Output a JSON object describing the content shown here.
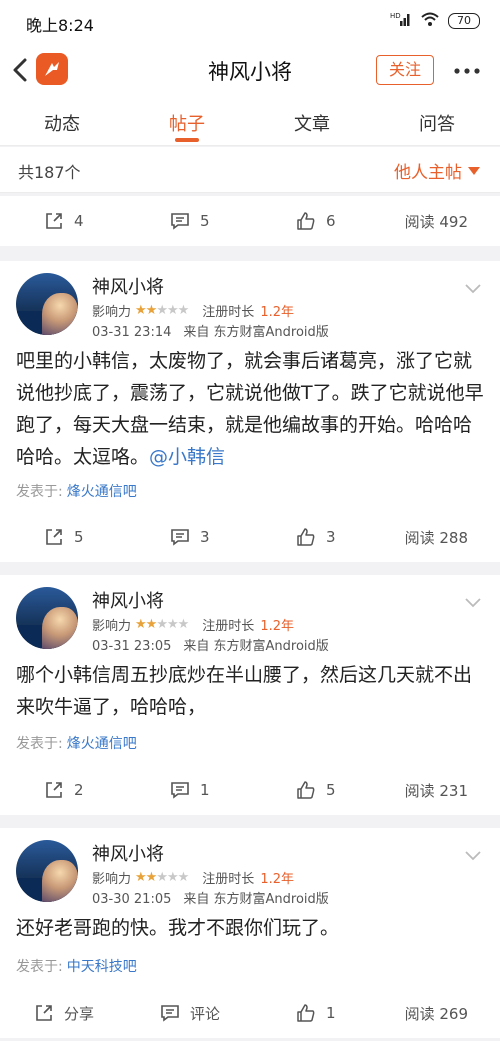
{
  "status_bar": {
    "time": "晚上8:24",
    "signal_label": "HD",
    "battery": "70"
  },
  "nav": {
    "title": "神风小将",
    "follow_label": "关注"
  },
  "tabs": [
    {
      "label": "动态",
      "active": false
    },
    {
      "label": "帖子",
      "active": true
    },
    {
      "label": "文章",
      "active": false
    },
    {
      "label": "问答",
      "active": false
    }
  ],
  "filter": {
    "count": "共187个",
    "dropdown_label": "他人主帖"
  },
  "top_actions": {
    "share": "4",
    "comment": "5",
    "like": "6",
    "read": "阅读 492"
  },
  "posts": [
    {
      "username": "神风小将",
      "influence_label": "影响力",
      "stars_on": 2,
      "reg_label": "注册时长",
      "reg_value": "1.2年",
      "time": "03-31 23:14",
      "source": "来自 东方财富Android版",
      "content": "吧里的小韩信，太废物了，就会事后诸葛亮，涨了它就说他抄底了，震荡了，它就说他做T了。跌了它就说他早跑了，每天大盘一结束，就是他编故事的开始。哈哈哈哈哈。太逗咯。",
      "mention": "@小韩信",
      "posted_in_label": "发表于:",
      "bar": "烽火通信吧",
      "actions": {
        "share": "5",
        "comment": "3",
        "like": "3",
        "read": "阅读 288"
      }
    },
    {
      "username": "神风小将",
      "influence_label": "影响力",
      "stars_on": 2,
      "reg_label": "注册时长",
      "reg_value": "1.2年",
      "time": "03-31 23:05",
      "source": "来自 东方财富Android版",
      "content": "哪个小韩信周五抄底炒在半山腰了，然后这几天就不出来吹牛逼了，哈哈哈，",
      "mention": "",
      "posted_in_label": "发表于:",
      "bar": "烽火通信吧",
      "actions": {
        "share": "2",
        "comment": "1",
        "like": "5",
        "read": "阅读 231"
      }
    },
    {
      "username": "神风小将",
      "influence_label": "影响力",
      "stars_on": 2,
      "reg_label": "注册时长",
      "reg_value": "1.2年",
      "time": "03-30 21:05",
      "source": "来自 东方财富Android版",
      "content": "还好老哥跑的快。我才不跟你们玩了。",
      "mention": "",
      "posted_in_label": "发表于:",
      "bar": "中天科技吧",
      "actions": {
        "share": "分享",
        "comment": "评论",
        "like": "1",
        "read": "阅读 269"
      }
    }
  ],
  "icons": {
    "back": "chevron-left-icon",
    "logo": "app-logo-icon",
    "more": "more-dots-icon",
    "share": "share-icon",
    "comment": "comment-icon",
    "like": "thumbs-up-icon",
    "collapse": "chevron-down-icon"
  },
  "colors": {
    "accent": "#e8612c",
    "link": "#3a78c9",
    "star": "#e8a23a"
  }
}
